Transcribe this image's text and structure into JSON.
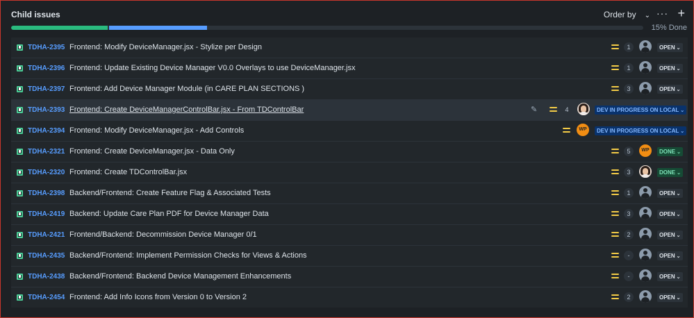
{
  "header": {
    "title": "Child issues",
    "order_label": "Order by",
    "order_chevron": "⌄",
    "more": "···",
    "add": "+"
  },
  "progress": {
    "done_fraction": 0.153,
    "in_progress_fraction": 0.155,
    "label": "15% Done",
    "colors": {
      "done": "#2abb7f",
      "in_progress": "#579dff",
      "todo": "#2c333a"
    }
  },
  "issues": [
    {
      "key": "TDHA-2395",
      "summary": "Frontend: Modify DeviceManager.jsx - Stylize per Design",
      "estimate": "1",
      "assignee": "unassigned",
      "status": "OPEN",
      "status_type": "open"
    },
    {
      "key": "TDHA-2396",
      "summary": "Frontend: Update Existing Device Manager V0.0 Overlays to use DeviceManager.jsx",
      "estimate": "1",
      "assignee": "unassigned",
      "status": "OPEN",
      "status_type": "open"
    },
    {
      "key": "TDHA-2397",
      "summary": "Frontend: Add Device Manager Module (in CARE PLAN SECTIONS )",
      "estimate": "3",
      "assignee": "unassigned",
      "status": "OPEN",
      "status_type": "open"
    },
    {
      "key": "TDHA-2393",
      "summary": "Frontend: Create DeviceManagerControlBar.jsx - From TDControlBar",
      "estimate": "4",
      "assignee": "photo",
      "status": "DEV IN PROGRESS ON LOCAL",
      "status_type": "inprog",
      "hover": true
    },
    {
      "key": "TDHA-2394",
      "summary": "Frontend: Modify DeviceManager.jsx - Add Controls",
      "estimate": "",
      "assignee": "WP",
      "status": "DEV IN PROGRESS ON LOCAL",
      "status_type": "inprog"
    },
    {
      "key": "TDHA-2321",
      "summary": "Frontend: Create DeviceManager.jsx - Data Only",
      "estimate": "5",
      "assignee": "WP",
      "status": "DONE",
      "status_type": "done"
    },
    {
      "key": "TDHA-2320",
      "summary": "Frontend: Create TDControlBar.jsx",
      "estimate": "3",
      "assignee": "photo",
      "status": "DONE",
      "status_type": "done"
    },
    {
      "key": "TDHA-2398",
      "summary": "Backend/Frontend: Create Feature Flag & Associated Tests",
      "estimate": "1",
      "assignee": "unassigned",
      "status": "OPEN",
      "status_type": "open"
    },
    {
      "key": "TDHA-2419",
      "summary": "Backend: Update Care Plan PDF for Device Manager Data",
      "estimate": "3",
      "assignee": "unassigned",
      "status": "OPEN",
      "status_type": "open"
    },
    {
      "key": "TDHA-2421",
      "summary": "Frontend/Backend: Decommission Device Manager 0/1",
      "estimate": "2",
      "assignee": "unassigned",
      "status": "OPEN",
      "status_type": "open"
    },
    {
      "key": "TDHA-2435",
      "summary": "Backend/Frontend: Implement Permission Checks for Views & Actions",
      "estimate": "-",
      "assignee": "unassigned",
      "status": "OPEN",
      "status_type": "open"
    },
    {
      "key": "TDHA-2438",
      "summary": "Backend/Frontend: Backend Device Management Enhancements",
      "estimate": "-",
      "assignee": "unassigned",
      "status": "OPEN",
      "status_type": "open"
    },
    {
      "key": "TDHA-2454",
      "summary": "Frontend: Add Info Icons from Version 0 to Version 2",
      "estimate": "2",
      "assignee": "unassigned",
      "status": "OPEN",
      "status_type": "open"
    }
  ],
  "icons": {
    "issue_type": "story-icon",
    "priority": "priority-medium-icon",
    "edit": "pencil-icon",
    "status_dropdown": "chevron-down-icon"
  }
}
